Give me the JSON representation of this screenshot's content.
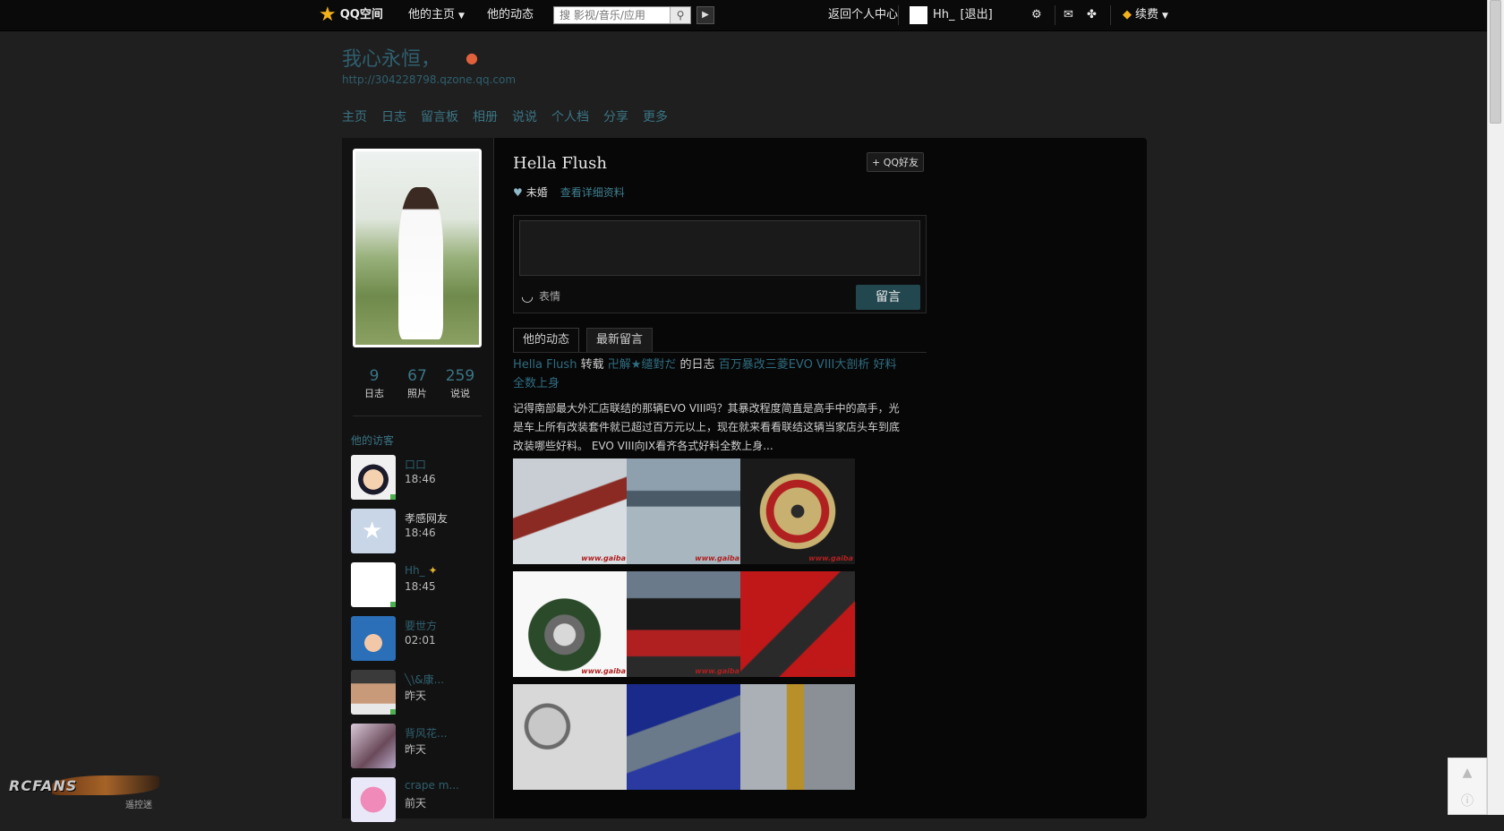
{
  "topbar": {
    "logo_text": "QQ空间",
    "nav_home": "他的主页",
    "nav_feed": "他的动态",
    "search_placeholder": "搜 影视/音乐/应用",
    "back_center": "返回个人中心",
    "username": "Hh_",
    "logout": "[退出]",
    "renew": "续费"
  },
  "header": {
    "title": "我心永恒，",
    "url": "http://304228798.qzone.qq.com",
    "nav": [
      "主页",
      "日志",
      "留言板",
      "相册",
      "说说",
      "个人档",
      "分享",
      "更多"
    ]
  },
  "profile": {
    "name": "Hella Flush",
    "add_friend": "QQ好友",
    "marital": "未婚",
    "details_link": "查看详细资料",
    "stats": [
      {
        "value": "9",
        "label": "日志"
      },
      {
        "value": "67",
        "label": "照片"
      },
      {
        "value": "259",
        "label": "说说"
      }
    ]
  },
  "visitors": {
    "title": "他的访客",
    "items": [
      {
        "name": "口口",
        "time": "18:46",
        "avatar": "cartoon-boy",
        "online": true
      },
      {
        "name": "孝感网友",
        "time": "18:46",
        "avatar": "qzone-default",
        "online": false
      },
      {
        "name": "Hh_",
        "time": "18:45",
        "avatar": "blank-white",
        "online": true
      },
      {
        "name": "要世方",
        "time": "02:01",
        "avatar": "blue-hat-cartoon",
        "online": false
      },
      {
        "name": "╲\\&康...",
        "time": "昨天",
        "avatar": "young-man",
        "online": true
      },
      {
        "name": "背风花...",
        "time": "昨天",
        "avatar": "girl-photo",
        "online": false
      },
      {
        "name": "crape m...",
        "time": "前天",
        "avatar": "pink-panther",
        "online": false
      }
    ]
  },
  "message_box": {
    "emoji_label": "表情",
    "submit_label": "留言"
  },
  "tabs": [
    "他的动态",
    "最新留言"
  ],
  "feed": {
    "author": "Hella Flush",
    "action": "转载",
    "source_user": "卍解★缱對だ",
    "of_text": "的日志",
    "post_title": "百万暴改三菱EVO VIII大剖析 好料全数上身",
    "excerpt": "记得南部最大外汇店联结的那辆EVO VIII吗？其暴改程度简直是高手中的高手，光是车上所有改装套件就已超过百万元以上，现在就来看看联结这辆当家店头车到底改装哪些好料。 EVO VIII向IX看齐各式好料全数上身...",
    "watermark": "www.gaiba"
  },
  "watermark_logo": {
    "brand": "RCFANS",
    "sub": "遥控迷"
  },
  "colors": {
    "accent": "#3a7585",
    "background": "#1f1f1f",
    "panel": "#070707",
    "button": "#23474f"
  }
}
